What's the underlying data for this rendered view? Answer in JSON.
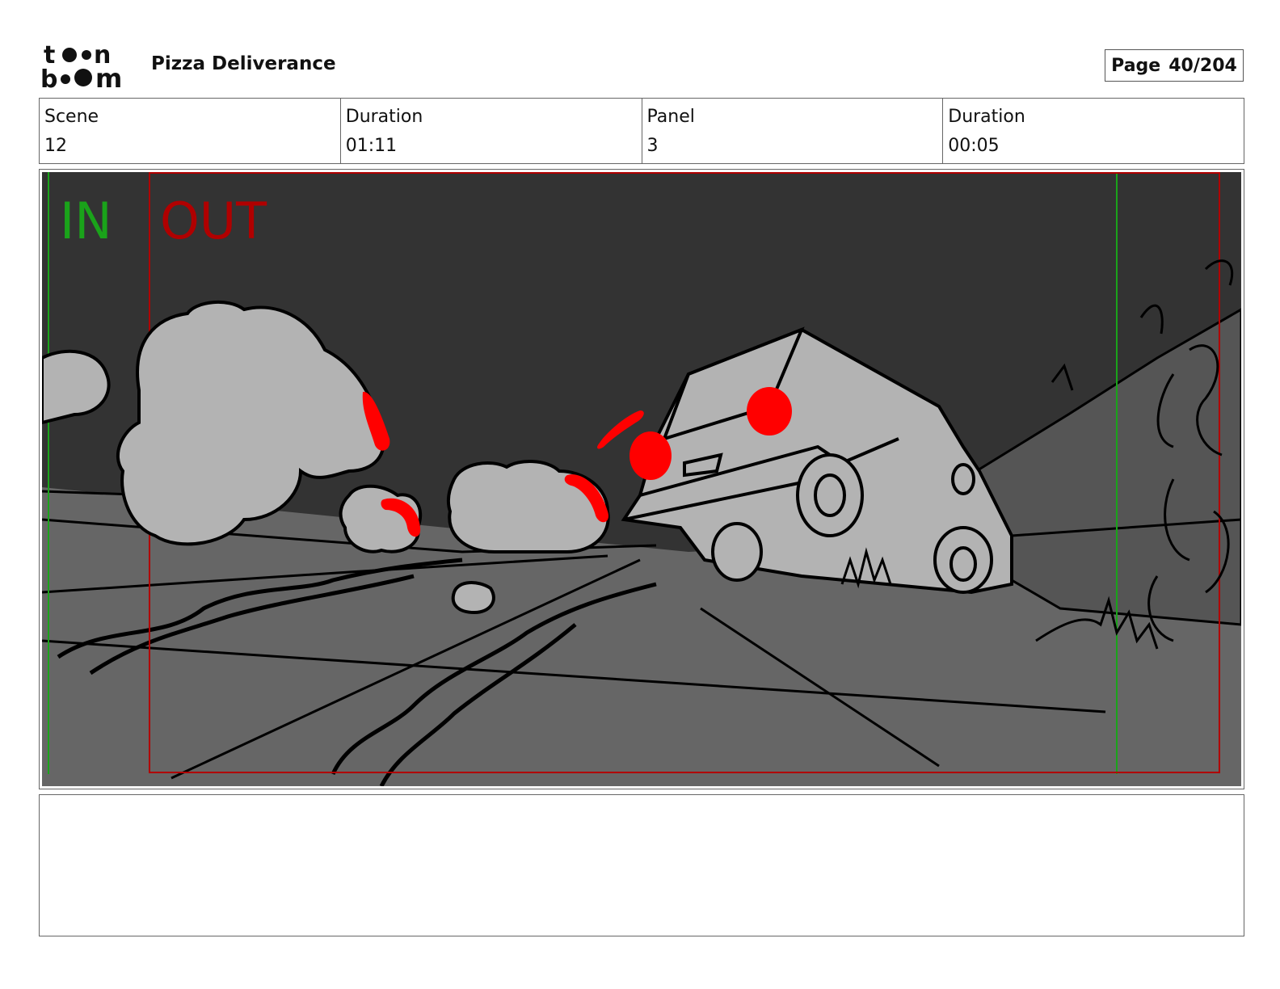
{
  "header": {
    "logo_text": "toonboom",
    "project_title": "Pizza Deliverance",
    "page_label": "Page",
    "page_number": "40/204"
  },
  "info": {
    "scene_label": "Scene",
    "scene_value": "12",
    "scene_duration_label": "Duration",
    "scene_duration_value": "01:11",
    "panel_label": "Panel",
    "panel_value": "3",
    "panel_duration_label": "Duration",
    "panel_duration_value": "00:05"
  },
  "panel": {
    "in_marker": "IN",
    "out_marker": "OUT",
    "in_color": "#1aa31a",
    "out_color": "#b00000",
    "sky_color": "#333333",
    "ground_color": "#666666",
    "cloud_color": "#b3b3b3",
    "highlight_color": "#ff0000"
  },
  "notes": {
    "text": ""
  }
}
